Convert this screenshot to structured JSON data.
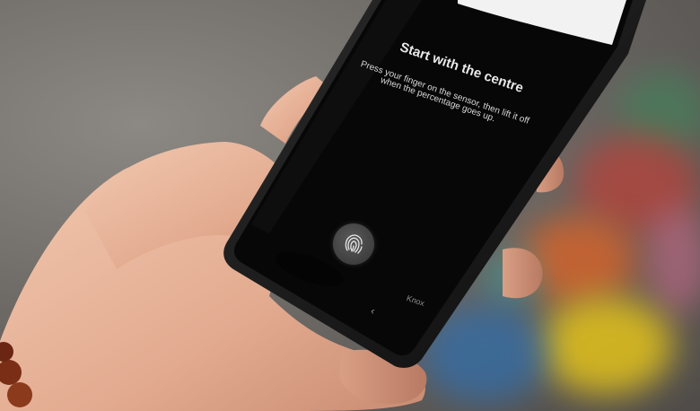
{
  "screen": {
    "title": "Start with the centre",
    "instruction_line1": "Press your finger on the sensor, then lift it off",
    "instruction_line2": "when the percentage goes up.",
    "knox_label": "Knox",
    "back_glyph": "‹"
  },
  "icons": {
    "fingerprint": "fingerprint-icon",
    "back": "back-chevron-icon"
  },
  "colors": {
    "screen_background": "#0a0a0a",
    "screen_text": "#e9e9e9"
  }
}
